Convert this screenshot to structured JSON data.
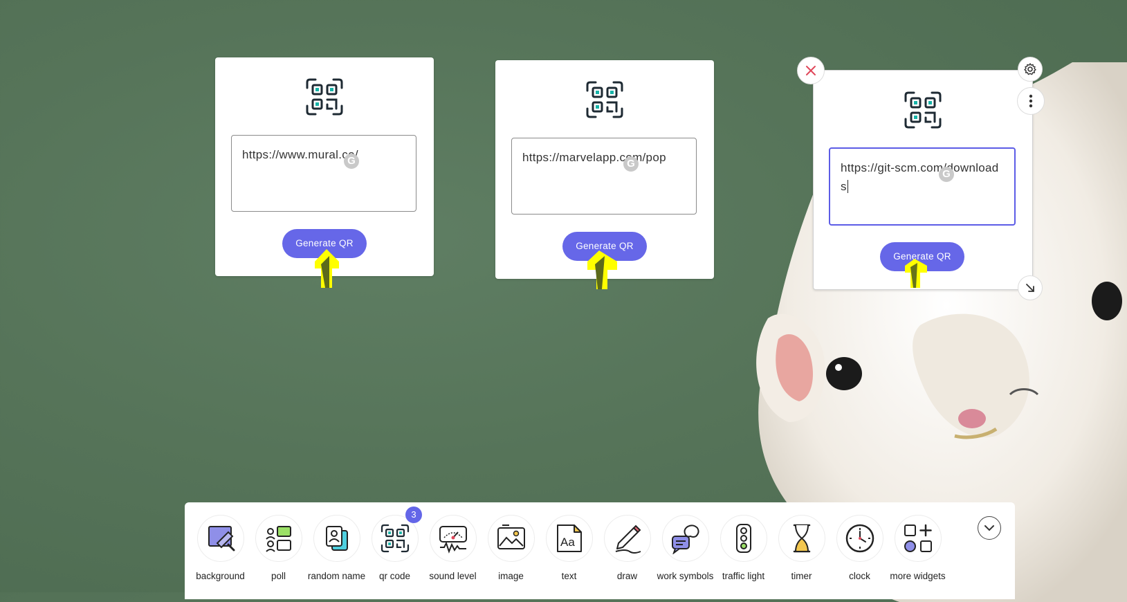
{
  "widgets": [
    {
      "url": "https://www.mural.co/",
      "button_label": "Generate QR"
    },
    {
      "url": "https://marvelapp.com/pop",
      "button_label": "Generate QR"
    },
    {
      "url": "https://git-scm.com/downloads",
      "button_label": "Generate QR"
    }
  ],
  "grammarly_badge": "G",
  "toolbar": {
    "items": [
      {
        "label": "background",
        "icon": "background-icon"
      },
      {
        "label": "poll",
        "icon": "poll-icon"
      },
      {
        "label": "random name",
        "icon": "random-name-icon"
      },
      {
        "label": "qr code",
        "icon": "qr-code-icon",
        "badge": "3"
      },
      {
        "label": "sound level",
        "icon": "sound-level-icon"
      },
      {
        "label": "image",
        "icon": "image-icon"
      },
      {
        "label": "text",
        "icon": "text-icon"
      },
      {
        "label": "draw",
        "icon": "draw-icon"
      },
      {
        "label": "work symbols",
        "icon": "work-symbols-icon"
      },
      {
        "label": "traffic light",
        "icon": "traffic-light-icon"
      },
      {
        "label": "timer",
        "icon": "timer-icon"
      },
      {
        "label": "clock",
        "icon": "clock-icon"
      },
      {
        "label": "more widgets",
        "icon": "more-widgets-icon"
      }
    ]
  },
  "colors": {
    "accent": "#6667e8",
    "close": "#e0475a",
    "cursor_highlight": "#ffff00"
  }
}
